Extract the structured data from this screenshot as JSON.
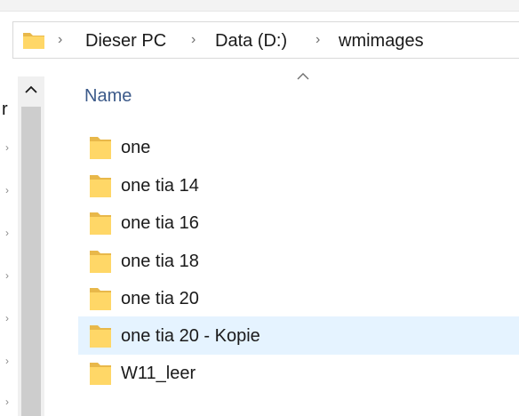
{
  "breadcrumb": {
    "items": [
      "Dieser PC",
      "Data (D:)",
      "wmimages"
    ]
  },
  "column_header": {
    "name_label": "Name"
  },
  "nav_pane": {
    "partial_letter": "r"
  },
  "files": [
    {
      "label": "one"
    },
    {
      "label": "one tia 14"
    },
    {
      "label": "one tia 16"
    },
    {
      "label": "one tia 18"
    },
    {
      "label": "one tia 20"
    },
    {
      "label": "one tia 20 - Kopie"
    },
    {
      "label": "W11_leer"
    }
  ],
  "colors": {
    "folder_fill": "#ffd767",
    "folder_shade": "#e8b84a",
    "selection": "#e5f3ff",
    "header_text": "#3c5a8a"
  },
  "icons": {
    "folder": "folder-icon",
    "chevron": "chevron-right-icon",
    "sort": "sort-ascending-icon",
    "scroll_up": "scroll-up-icon"
  }
}
